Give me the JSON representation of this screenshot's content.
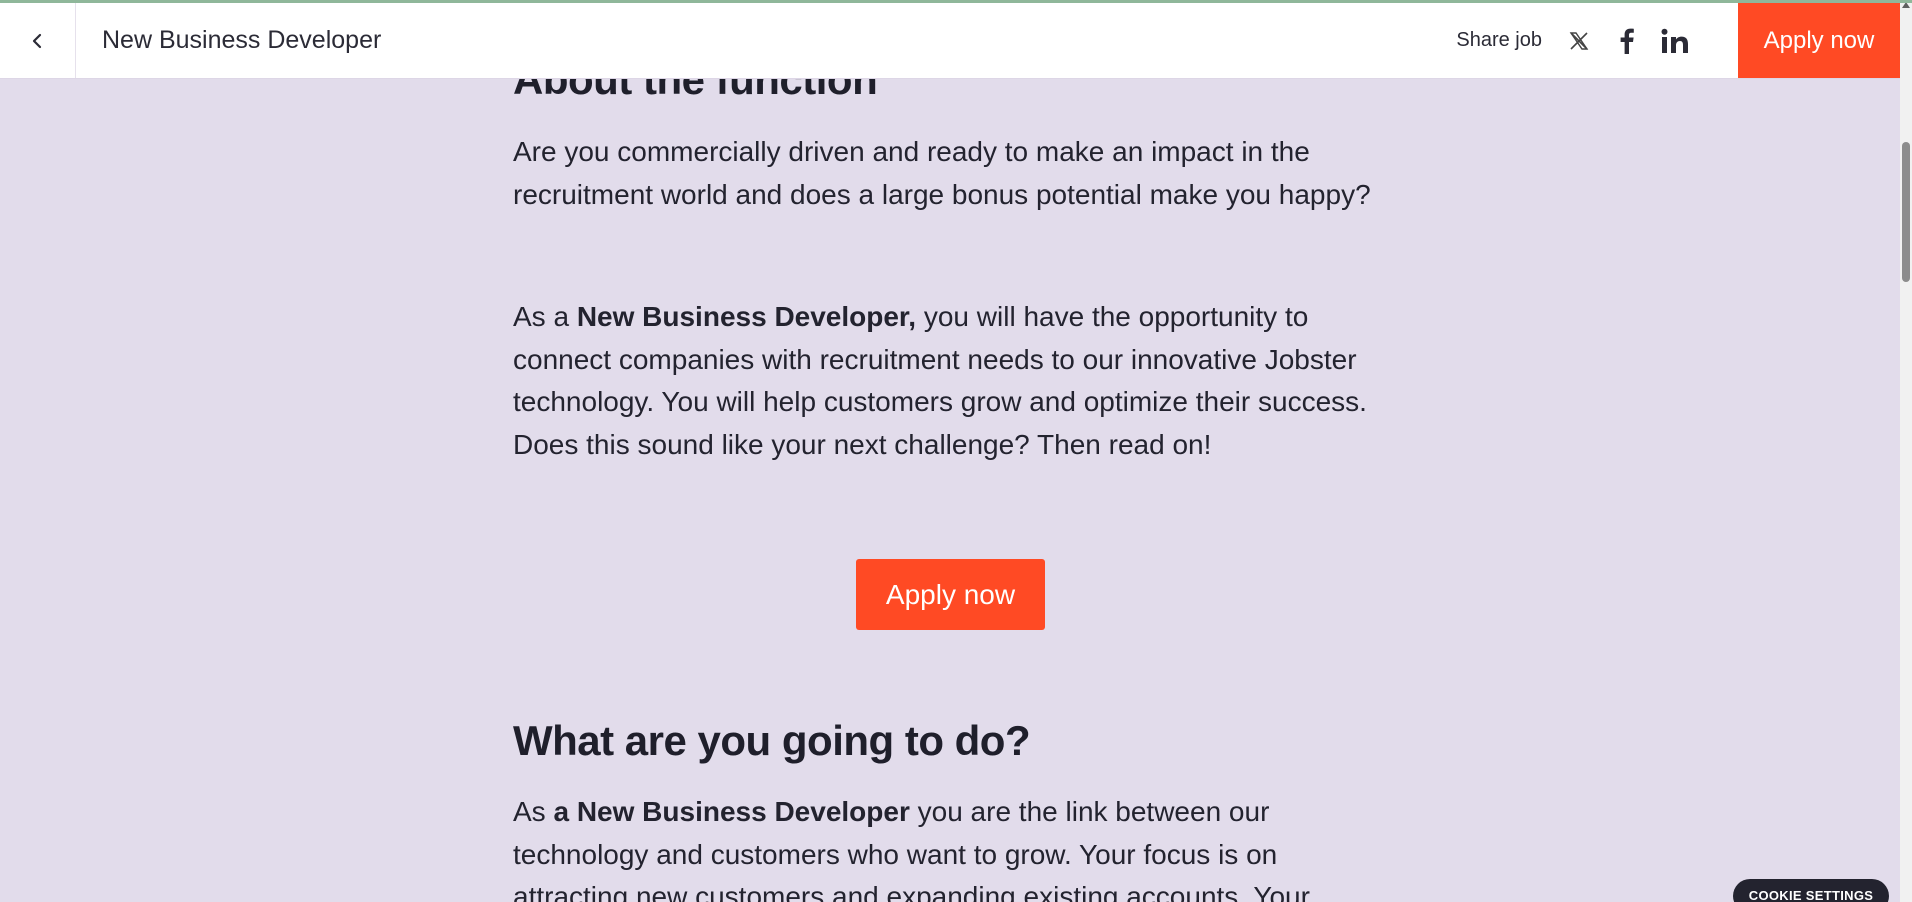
{
  "header": {
    "title": "New Business Developer",
    "share_label": "Share job",
    "share_icons": [
      "x-icon",
      "facebook-icon",
      "linkedin-icon"
    ],
    "apply_label": "Apply now"
  },
  "content": {
    "about_heading": "About the function",
    "p1": "Are you commercially driven and ready to make an impact in the recruitment world and does a large bonus potential make you happy?",
    "p2_prefix": "As a ",
    "p2_bold": "New Business Developer,",
    "p2_rest": " you will have the opportunity to connect companies with recruitment needs to our innovative Jobster technology. You will help customers grow and optimize their success. Does this sound like your next challenge? Then read on!",
    "apply_label": "Apply now",
    "what_heading": "What are you going to do?",
    "p3_prefix": "As ",
    "p3_bold": "a New Business Developer",
    "p3_rest": " you are the link between our technology and customers who want to grow. Your focus is on attracting new customers and expanding existing accounts. Your"
  },
  "cookie": {
    "label": "COOKIE SETTINGS"
  },
  "colors": {
    "background": "#e2dceb",
    "accent": "#ff4a24",
    "text": "#1f1f2b",
    "cookie_bg": "#23232f"
  }
}
